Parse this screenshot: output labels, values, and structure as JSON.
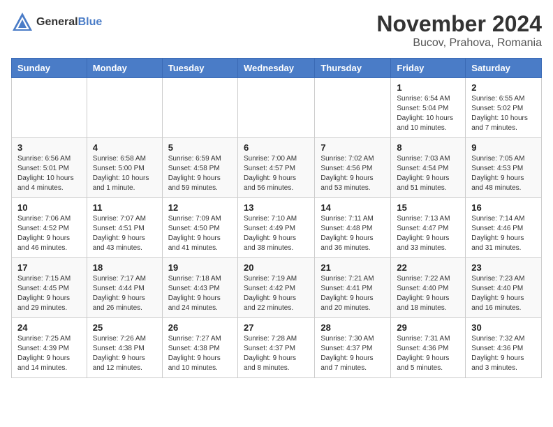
{
  "logo": {
    "text_general": "General",
    "text_blue": "Blue"
  },
  "title": {
    "month": "November 2024",
    "location": "Bucov, Prahova, Romania"
  },
  "headers": [
    "Sunday",
    "Monday",
    "Tuesday",
    "Wednesday",
    "Thursday",
    "Friday",
    "Saturday"
  ],
  "weeks": [
    [
      {
        "day": "",
        "info": ""
      },
      {
        "day": "",
        "info": ""
      },
      {
        "day": "",
        "info": ""
      },
      {
        "day": "",
        "info": ""
      },
      {
        "day": "",
        "info": ""
      },
      {
        "day": "1",
        "info": "Sunrise: 6:54 AM\nSunset: 5:04 PM\nDaylight: 10 hours and 10 minutes."
      },
      {
        "day": "2",
        "info": "Sunrise: 6:55 AM\nSunset: 5:02 PM\nDaylight: 10 hours and 7 minutes."
      }
    ],
    [
      {
        "day": "3",
        "info": "Sunrise: 6:56 AM\nSunset: 5:01 PM\nDaylight: 10 hours and 4 minutes."
      },
      {
        "day": "4",
        "info": "Sunrise: 6:58 AM\nSunset: 5:00 PM\nDaylight: 10 hours and 1 minute."
      },
      {
        "day": "5",
        "info": "Sunrise: 6:59 AM\nSunset: 4:58 PM\nDaylight: 9 hours and 59 minutes."
      },
      {
        "day": "6",
        "info": "Sunrise: 7:00 AM\nSunset: 4:57 PM\nDaylight: 9 hours and 56 minutes."
      },
      {
        "day": "7",
        "info": "Sunrise: 7:02 AM\nSunset: 4:56 PM\nDaylight: 9 hours and 53 minutes."
      },
      {
        "day": "8",
        "info": "Sunrise: 7:03 AM\nSunset: 4:54 PM\nDaylight: 9 hours and 51 minutes."
      },
      {
        "day": "9",
        "info": "Sunrise: 7:05 AM\nSunset: 4:53 PM\nDaylight: 9 hours and 48 minutes."
      }
    ],
    [
      {
        "day": "10",
        "info": "Sunrise: 7:06 AM\nSunset: 4:52 PM\nDaylight: 9 hours and 46 minutes."
      },
      {
        "day": "11",
        "info": "Sunrise: 7:07 AM\nSunset: 4:51 PM\nDaylight: 9 hours and 43 minutes."
      },
      {
        "day": "12",
        "info": "Sunrise: 7:09 AM\nSunset: 4:50 PM\nDaylight: 9 hours and 41 minutes."
      },
      {
        "day": "13",
        "info": "Sunrise: 7:10 AM\nSunset: 4:49 PM\nDaylight: 9 hours and 38 minutes."
      },
      {
        "day": "14",
        "info": "Sunrise: 7:11 AM\nSunset: 4:48 PM\nDaylight: 9 hours and 36 minutes."
      },
      {
        "day": "15",
        "info": "Sunrise: 7:13 AM\nSunset: 4:47 PM\nDaylight: 9 hours and 33 minutes."
      },
      {
        "day": "16",
        "info": "Sunrise: 7:14 AM\nSunset: 4:46 PM\nDaylight: 9 hours and 31 minutes."
      }
    ],
    [
      {
        "day": "17",
        "info": "Sunrise: 7:15 AM\nSunset: 4:45 PM\nDaylight: 9 hours and 29 minutes."
      },
      {
        "day": "18",
        "info": "Sunrise: 7:17 AM\nSunset: 4:44 PM\nDaylight: 9 hours and 26 minutes."
      },
      {
        "day": "19",
        "info": "Sunrise: 7:18 AM\nSunset: 4:43 PM\nDaylight: 9 hours and 24 minutes."
      },
      {
        "day": "20",
        "info": "Sunrise: 7:19 AM\nSunset: 4:42 PM\nDaylight: 9 hours and 22 minutes."
      },
      {
        "day": "21",
        "info": "Sunrise: 7:21 AM\nSunset: 4:41 PM\nDaylight: 9 hours and 20 minutes."
      },
      {
        "day": "22",
        "info": "Sunrise: 7:22 AM\nSunset: 4:40 PM\nDaylight: 9 hours and 18 minutes."
      },
      {
        "day": "23",
        "info": "Sunrise: 7:23 AM\nSunset: 4:40 PM\nDaylight: 9 hours and 16 minutes."
      }
    ],
    [
      {
        "day": "24",
        "info": "Sunrise: 7:25 AM\nSunset: 4:39 PM\nDaylight: 9 hours and 14 minutes."
      },
      {
        "day": "25",
        "info": "Sunrise: 7:26 AM\nSunset: 4:38 PM\nDaylight: 9 hours and 12 minutes."
      },
      {
        "day": "26",
        "info": "Sunrise: 7:27 AM\nSunset: 4:38 PM\nDaylight: 9 hours and 10 minutes."
      },
      {
        "day": "27",
        "info": "Sunrise: 7:28 AM\nSunset: 4:37 PM\nDaylight: 9 hours and 8 minutes."
      },
      {
        "day": "28",
        "info": "Sunrise: 7:30 AM\nSunset: 4:37 PM\nDaylight: 9 hours and 7 minutes."
      },
      {
        "day": "29",
        "info": "Sunrise: 7:31 AM\nSunset: 4:36 PM\nDaylight: 9 hours and 5 minutes."
      },
      {
        "day": "30",
        "info": "Sunrise: 7:32 AM\nSunset: 4:36 PM\nDaylight: 9 hours and 3 minutes."
      }
    ]
  ]
}
